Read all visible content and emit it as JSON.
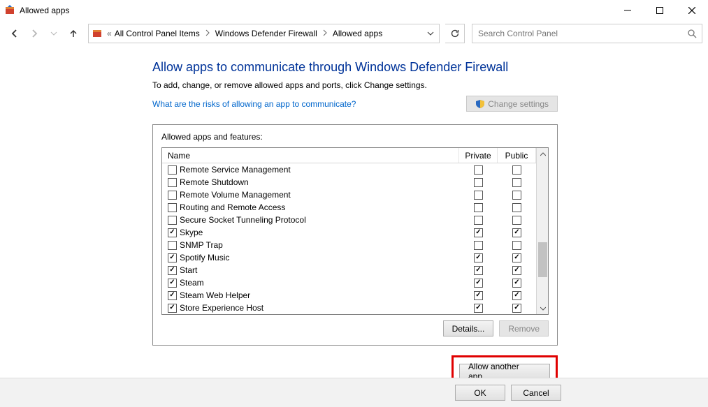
{
  "window": {
    "title": "Allowed apps"
  },
  "breadcrumbs": {
    "prefix_chevrons": "«",
    "items": [
      "All Control Panel Items",
      "Windows Defender Firewall",
      "Allowed apps"
    ]
  },
  "search": {
    "placeholder": "Search Control Panel"
  },
  "page": {
    "heading": "Allow apps to communicate through Windows Defender Firewall",
    "subtext": "To add, change, or remove allowed apps and ports, click Change settings.",
    "risks_link": "What are the risks of allowing an app to communicate?",
    "change_settings_label": "Change settings"
  },
  "panel": {
    "title": "Allowed apps and features:",
    "columns": {
      "name": "Name",
      "private": "Private",
      "public": "Public"
    },
    "rows": [
      {
        "name": "Remote Service Management",
        "enabled": false,
        "private": false,
        "public": false
      },
      {
        "name": "Remote Shutdown",
        "enabled": false,
        "private": false,
        "public": false
      },
      {
        "name": "Remote Volume Management",
        "enabled": false,
        "private": false,
        "public": false
      },
      {
        "name": "Routing and Remote Access",
        "enabled": false,
        "private": false,
        "public": false
      },
      {
        "name": "Secure Socket Tunneling Protocol",
        "enabled": false,
        "private": false,
        "public": false
      },
      {
        "name": "Skype",
        "enabled": true,
        "private": true,
        "public": true
      },
      {
        "name": "SNMP Trap",
        "enabled": false,
        "private": false,
        "public": false
      },
      {
        "name": "Spotify Music",
        "enabled": true,
        "private": true,
        "public": true
      },
      {
        "name": "Start",
        "enabled": true,
        "private": true,
        "public": true
      },
      {
        "name": "Steam",
        "enabled": true,
        "private": true,
        "public": true
      },
      {
        "name": "Steam Web Helper",
        "enabled": true,
        "private": true,
        "public": true
      },
      {
        "name": "Store Experience Host",
        "enabled": true,
        "private": true,
        "public": true
      }
    ],
    "details_label": "Details...",
    "remove_label": "Remove",
    "allow_another_label": "Allow another app..."
  },
  "footer": {
    "ok": "OK",
    "cancel": "Cancel"
  }
}
